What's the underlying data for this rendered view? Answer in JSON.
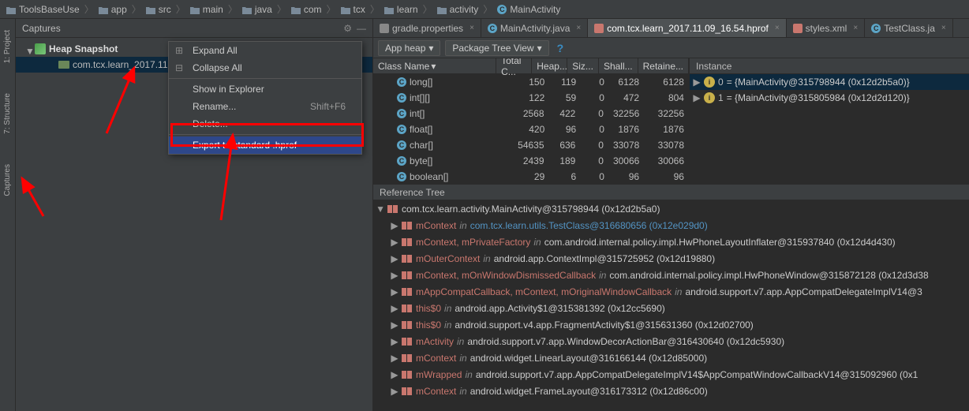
{
  "breadcrumb": [
    "ToolsBaseUse",
    "app",
    "src",
    "main",
    "java",
    "com",
    "tcx",
    "learn",
    "activity",
    "MainActivity"
  ],
  "left_tools": {
    "t1": "1: Project",
    "t2": "7: Structure",
    "t3": "Captures"
  },
  "captures": {
    "title": "Captures",
    "heap_label": "Heap Snapshot",
    "file": "com.tcx.learn_2017.11.09_16.54.hprof"
  },
  "context_menu": {
    "expand": "Expand All",
    "collapse": "Collapse All",
    "show": "Show in Explorer",
    "rename": "Rename...",
    "rename_sc": "Shift+F6",
    "delete": "Delete...",
    "export": "Export to standard .hprof"
  },
  "editor_tabs": [
    {
      "icon": "props",
      "label": "gradle.properties"
    },
    {
      "icon": "class",
      "label": "MainActivity.java"
    },
    {
      "icon": "file",
      "label": "com.tcx.learn_2017.11.09_16.54.hprof",
      "active": true
    },
    {
      "icon": "file",
      "label": "styles.xml"
    },
    {
      "icon": "class",
      "label": "TestClass.ja"
    }
  ],
  "dropdowns": {
    "d1": "App heap",
    "d2": "Package Tree View"
  },
  "class_table": {
    "headers": [
      "Class Name",
      "Total C...",
      "Heap...",
      "Siz...",
      "Shall...",
      "Retaine..."
    ],
    "rows": [
      {
        "name": "long[]",
        "tc": "150",
        "heap": "119",
        "siz": "0",
        "shall": "6128",
        "ret": "6128"
      },
      {
        "name": "int[][]",
        "tc": "122",
        "heap": "59",
        "siz": "0",
        "shall": "472",
        "ret": "804"
      },
      {
        "name": "int[]",
        "tc": "2568",
        "heap": "422",
        "siz": "0",
        "shall": "32256",
        "ret": "32256"
      },
      {
        "name": "float[]",
        "tc": "420",
        "heap": "96",
        "siz": "0",
        "shall": "1876",
        "ret": "1876"
      },
      {
        "name": "char[]",
        "tc": "54635",
        "heap": "636",
        "siz": "0",
        "shall": "33078",
        "ret": "33078"
      },
      {
        "name": "byte[]",
        "tc": "2439",
        "heap": "189",
        "siz": "0",
        "shall": "30066",
        "ret": "30066"
      },
      {
        "name": "boolean[]",
        "tc": "29",
        "heap": "6",
        "siz": "0",
        "shall": "96",
        "ret": "96"
      }
    ]
  },
  "instance": {
    "header": "Instance",
    "rows": [
      {
        "idx": "0",
        "val": "= {MainActivity@315798944 (0x12d2b5a0)}"
      },
      {
        "idx": "1",
        "val": "= {MainActivity@315805984 (0x12d2d120)}"
      }
    ]
  },
  "ref_tree": {
    "header": "Reference Tree",
    "root": "com.tcx.learn.activity.MainActivity@315798944 (0x12d2b5a0)",
    "rows": [
      {
        "fields": "mContext",
        "in": "in",
        "link": "com.tcx.learn.utils.TestClass@316680656 (0x12e029d0)",
        "plain": ""
      },
      {
        "fields": "mContext, mPrivateFactory",
        "in": "in",
        "link": "",
        "plain": "com.android.internal.policy.impl.HwPhoneLayoutInflater@315937840 (0x12d4d430)"
      },
      {
        "fields": "mOuterContext",
        "in": "in",
        "link": "",
        "plain": "android.app.ContextImpl@315725952 (0x12d19880)"
      },
      {
        "fields": "mContext, mOnWindowDismissedCallback",
        "in": "in",
        "link": "",
        "plain": "com.android.internal.policy.impl.HwPhoneWindow@315872128 (0x12d3d38"
      },
      {
        "fields": "mAppCompatCallback, mContext, mOriginalWindowCallback",
        "in": "in",
        "link": "",
        "plain": "android.support.v7.app.AppCompatDelegateImplV14@3"
      },
      {
        "fields": "this$0",
        "in": "in",
        "link": "",
        "plain": "android.app.Activity$1@315381392 (0x12cc5690)"
      },
      {
        "fields": "this$0",
        "in": "in",
        "link": "",
        "plain": "android.support.v4.app.FragmentActivity$1@315631360 (0x12d02700)"
      },
      {
        "fields": "mActivity",
        "in": "in",
        "link": "",
        "plain": "android.support.v7.app.WindowDecorActionBar@316430640 (0x12dc5930)"
      },
      {
        "fields": "mContext",
        "in": "in",
        "link": "",
        "plain": "android.widget.LinearLayout@316166144 (0x12d85000)"
      },
      {
        "fields": "mWrapped",
        "in": "in",
        "link": "",
        "plain": "android.support.v7.app.AppCompatDelegateImplV14$AppCompatWindowCallbackV14@315092960 (0x1"
      },
      {
        "fields": "mContext",
        "in": "in",
        "link": "",
        "plain": "android.widget.FrameLayout@316173312 (0x12d86c00)"
      }
    ]
  },
  "watermark": ""
}
